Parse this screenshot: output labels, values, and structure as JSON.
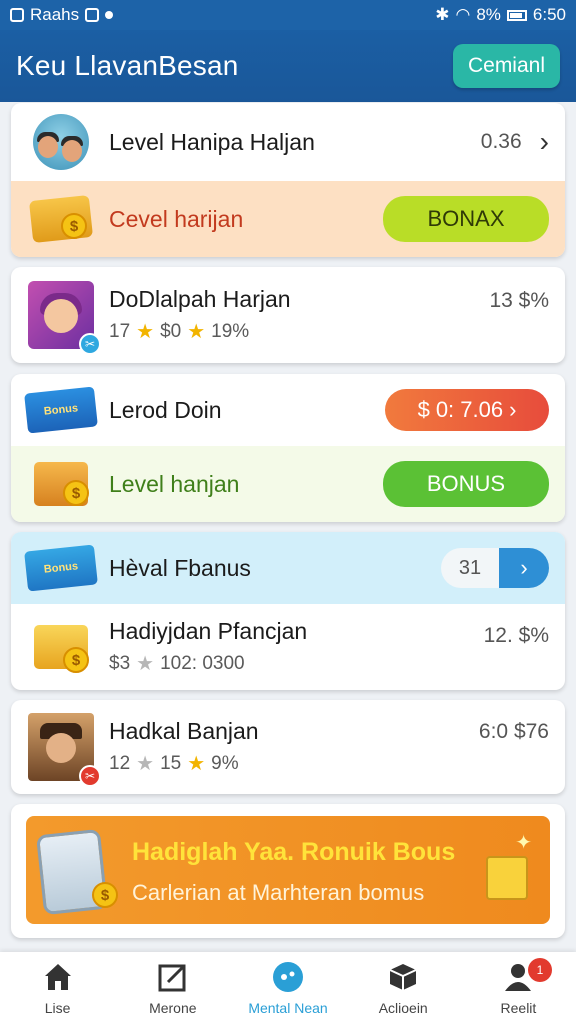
{
  "status_bar": {
    "left_text": "Raahs",
    "right_text": "8%",
    "time": "6:50"
  },
  "header": {
    "title": "Keu LlavanBesan",
    "button_label": "Cemianl"
  },
  "card1": {
    "title": "Level Hanipa Haljan",
    "value": "0.36",
    "bonus_label": "Cevel harijan",
    "bonus_button": "BONAX"
  },
  "card2": {
    "title": "DoDlalpah Harjan",
    "value": "13 $%",
    "stat1": "17",
    "stat2": "$0",
    "stat3": "19%"
  },
  "card3": {
    "title": "Lerod Doin",
    "timer": "0: 7.06",
    "bonus_label": "Level hanjan",
    "bonus_button": "BONUS"
  },
  "card4": {
    "title": "Hèval Fbanus",
    "counter": "31",
    "item_title": "Hadiyjdan Pfancjan",
    "item_value": "12. $%",
    "stat1": "$3",
    "stat2": "102: 0300"
  },
  "card5": {
    "title": "Hadkal Banjan",
    "value": "6:0 $76",
    "stat1": "12",
    "stat2": "15",
    "stat3": "9%"
  },
  "promo": {
    "title": "Hadiglah Yaa. Ronuik Bous",
    "subtitle": "Carlerian at Marhteran bomus"
  },
  "nav": {
    "items": [
      {
        "label": "Lise"
      },
      {
        "label": "Merone"
      },
      {
        "label": "Mental Nean"
      },
      {
        "label": "Aclioein"
      },
      {
        "label": "Reelit"
      }
    ],
    "notification": "1"
  },
  "colors": {
    "primary": "#1b5fa4",
    "accent": "#2ab7a6",
    "lime": "#b9dd27",
    "green": "#5bc135",
    "orange": "#f39a2c"
  }
}
